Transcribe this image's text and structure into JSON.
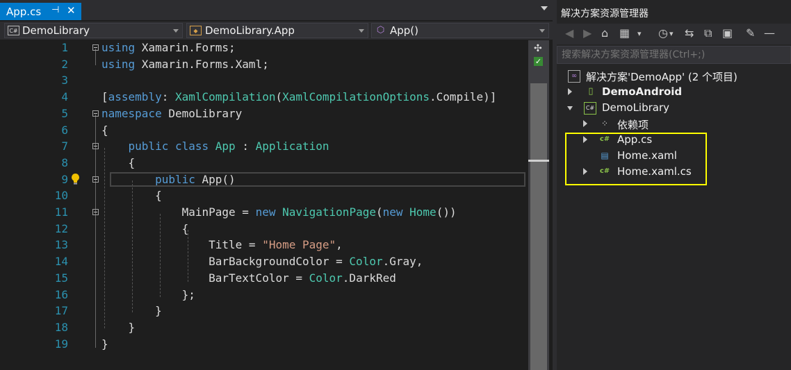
{
  "editor": {
    "tab": {
      "name": "App.cs",
      "pin": "⊣",
      "close": "✕"
    },
    "nav": {
      "project": "DemoLibrary",
      "project_icon": "C#",
      "class": "DemoLibrary.App",
      "member": "App()"
    },
    "lines": [
      {
        "n": "1",
        "html": "<span class='kw'>using</span> Xamarin.Forms;"
      },
      {
        "n": "2",
        "html": "<span class='kw'>using</span> Xamarin.Forms.Xaml;"
      },
      {
        "n": "3",
        "html": ""
      },
      {
        "n": "4",
        "html": "[<span class='kw'>assembly</span>: <span class='ty'>XamlCompilation</span>(<span class='ty'>XamlCompilationOptions</span>.Compile)]"
      },
      {
        "n": "5",
        "html": "<span class='kw'>namespace</span> DemoLibrary"
      },
      {
        "n": "6",
        "html": "{"
      },
      {
        "n": "7",
        "html": "    <span class='kw'>public</span> <span class='kw'>class</span> <span class='ty'>App</span> : <span class='ty'>Application</span>"
      },
      {
        "n": "8",
        "html": "    {"
      },
      {
        "n": "9",
        "html": "        <span class='kw'>public</span> App()"
      },
      {
        "n": "10",
        "html": "        {"
      },
      {
        "n": "11",
        "html": "            MainPage = <span class='kw'>new</span> <span class='ty'>NavigationPage</span>(<span class='kw'>new</span> <span class='ty'>Home</span>())"
      },
      {
        "n": "12",
        "html": "            {"
      },
      {
        "n": "13",
        "html": "                Title = <span class='st'>\"Home Page\"</span>,"
      },
      {
        "n": "14",
        "html": "                BarBackgroundColor = <span class='ty'>Color</span>.Gray,"
      },
      {
        "n": "15",
        "html": "                BarTextColor = <span class='ty'>Color</span>.DarkRed"
      },
      {
        "n": "16",
        "html": "            };"
      },
      {
        "n": "17",
        "html": "        }"
      },
      {
        "n": "18",
        "html": "    }"
      },
      {
        "n": "19",
        "html": "}"
      }
    ]
  },
  "solution_explorer": {
    "title": "解决方案资源管理器",
    "search_placeholder": "搜索解决方案资源管理器(Ctrl+;)",
    "solution_label": "解决方案'DemoApp' (2 个项目)",
    "items": {
      "demo_android": "DemoAndroid",
      "demo_library": "DemoLibrary",
      "dependencies": "依赖项",
      "app_cs": "App.cs",
      "home_xaml": "Home.xaml",
      "home_xaml_cs": "Home.xaml.cs"
    }
  },
  "colors": {
    "accent": "#007acc",
    "keyword": "#569cd6",
    "type": "#4ec9b0",
    "string": "#d69d85",
    "highlight_box": "#ffff00"
  }
}
